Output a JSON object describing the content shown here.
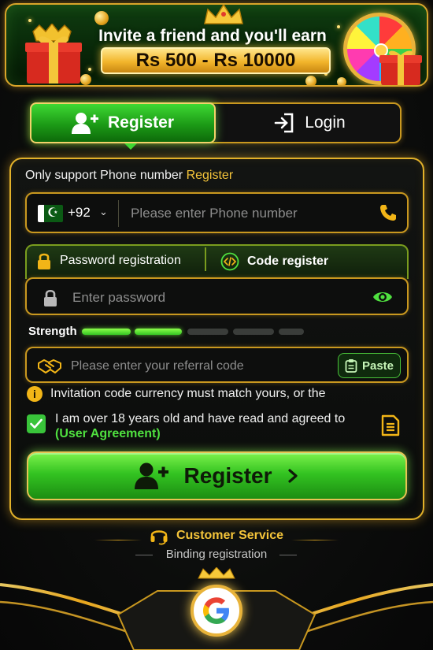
{
  "banner": {
    "title": "Invite a friend and you'll earn",
    "amount": "Rs 500 - Rs 10000"
  },
  "tabs": {
    "register_label": "Register",
    "login_label": "Login",
    "active": "register"
  },
  "form": {
    "notice_prefix": "Only support Phone number ",
    "notice_highlight": "Register",
    "phone": {
      "country_code": "+92",
      "placeholder": "Please enter Phone number",
      "value": ""
    },
    "registration_types": [
      "Password registration",
      "Code register"
    ],
    "password": {
      "placeholder": "Enter password",
      "value": ""
    },
    "strength": {
      "label": "Strength",
      "filled": 2,
      "total": 5
    },
    "referral": {
      "placeholder": "Please enter your referral code",
      "value": "",
      "paste_label": "Paste"
    },
    "info_text": "Invitation code currency must match yours, or the",
    "agreement": {
      "checked": true,
      "text": "I am over 18 years old and have read and agreed to",
      "link": "(User Agreement)"
    },
    "submit_label": "Register"
  },
  "footer": {
    "customer_service": "Customer Service",
    "binding": "Binding registration"
  },
  "colors": {
    "accent_gold": "#e2b12a",
    "accent_green": "#33c321",
    "link_green": "#4fe03f",
    "highlight_yellow": "#f4c43a"
  }
}
